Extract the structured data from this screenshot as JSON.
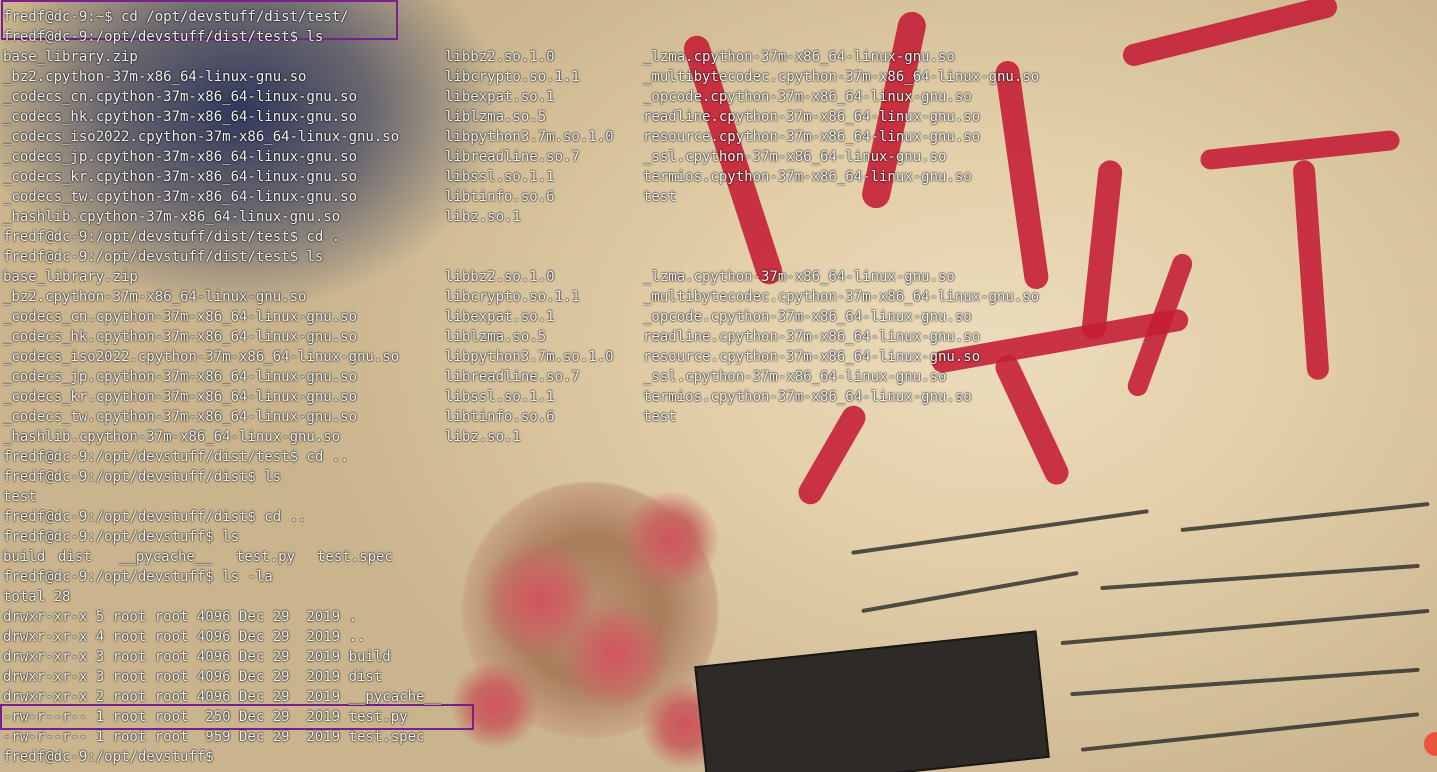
{
  "terminal": {
    "cmd_cd_test": "fredf@dc-9:/opt/devstuff/dist/test",
    "prompt_line_top": "fredf@dc-9:~$ cd /opt/devstuff/dist/test/",
    "prompt_ls_1": "fredf@dc-9:/opt/devstuff/dist/test$ ls",
    "ls_rows": [
      [
        "base_library.zip",
        "libbz2.so.1.0",
        "_lzma.cpython-37m-x86_64-linux-gnu.so"
      ],
      [
        "_bz2.cpython-37m-x86_64-linux-gnu.so",
        "libcrypto.so.1.1",
        "_multibytecodec.cpython-37m-x86_64-linux-gnu.so"
      ],
      [
        "_codecs_cn.cpython-37m-x86_64-linux-gnu.so",
        "libexpat.so.1",
        "_opcode.cpython-37m-x86_64-linux-gnu.so"
      ],
      [
        "_codecs_hk.cpython-37m-x86_64-linux-gnu.so",
        "liblzma.so.5",
        "readline.cpython-37m-x86_64-linux-gnu.so"
      ],
      [
        "_codecs_iso2022.cpython-37m-x86_64-linux-gnu.so",
        "libpython3.7m.so.1.0",
        "resource.cpython-37m-x86_64-linux-gnu.so"
      ],
      [
        "_codecs_jp.cpython-37m-x86_64-linux-gnu.so",
        "libreadline.so.7",
        "_ssl.cpython-37m-x86_64-linux-gnu.so"
      ],
      [
        "_codecs_kr.cpython-37m-x86_64-linux-gnu.so",
        "libssl.so.1.1",
        "termios.cpython-37m-x86_64-linux-gnu.so"
      ],
      [
        "_codecs_tw.cpython-37m-x86_64-linux-gnu.so",
        "libtinfo.so.6",
        "test"
      ],
      [
        "_hashlib.cpython-37m-x86_64-linux-gnu.so",
        "libz.so.1",
        ""
      ]
    ],
    "prompt_cd_dot": "fredf@dc-9:/opt/devstuff/dist/test$ cd .",
    "prompt_ls_2": "fredf@dc-9:/opt/devstuff/dist/test$ ls",
    "prompt_cd_up_1": "fredf@dc-9:/opt/devstuff/dist/test$ cd ..",
    "prompt_ls_3": "fredf@dc-9:/opt/devstuff/dist$ ls",
    "dist_listing": "test",
    "prompt_cd_up_2": "fredf@dc-9:/opt/devstuff/dist$ cd ..",
    "prompt_ls_4": "fredf@dc-9:/opt/devstuff$ ls",
    "devstuff_listing": [
      "build",
      "dist",
      "__pycache__",
      "test.py",
      "test.spec"
    ],
    "prompt_ls_la": "fredf@dc-9:/opt/devstuff$ ls -la",
    "total_line": "total 28",
    "la_rows": [
      [
        "drwxr-xr-x 5 root root 4096 Dec 29  2019 ."
      ],
      [
        "drwxr-xr-x 4 root root 4096 Dec 29  2019 .."
      ],
      [
        "drwxr-xr-x 3 root root 4096 Dec 29  2019 build"
      ],
      [
        "drwxr-xr-x 3 root root 4096 Dec 29  2019 dist"
      ],
      [
        "drwxr-xr-x 2 root root 4096 Dec 29  2019 __pycache__"
      ],
      [
        "-rw-r--r-- 1 root root  250 Dec 29  2019 test.py"
      ],
      [
        "-rw-r--r-- 1 root root  959 Dec 29  2019 test.spec"
      ]
    ],
    "prompt_final": "fredf@dc-9:/opt/devstuff$"
  },
  "colors": {
    "text": "#f2f2f2",
    "highlight_box": "#7a1f8c",
    "calligraphy_red": "#c41b33"
  }
}
